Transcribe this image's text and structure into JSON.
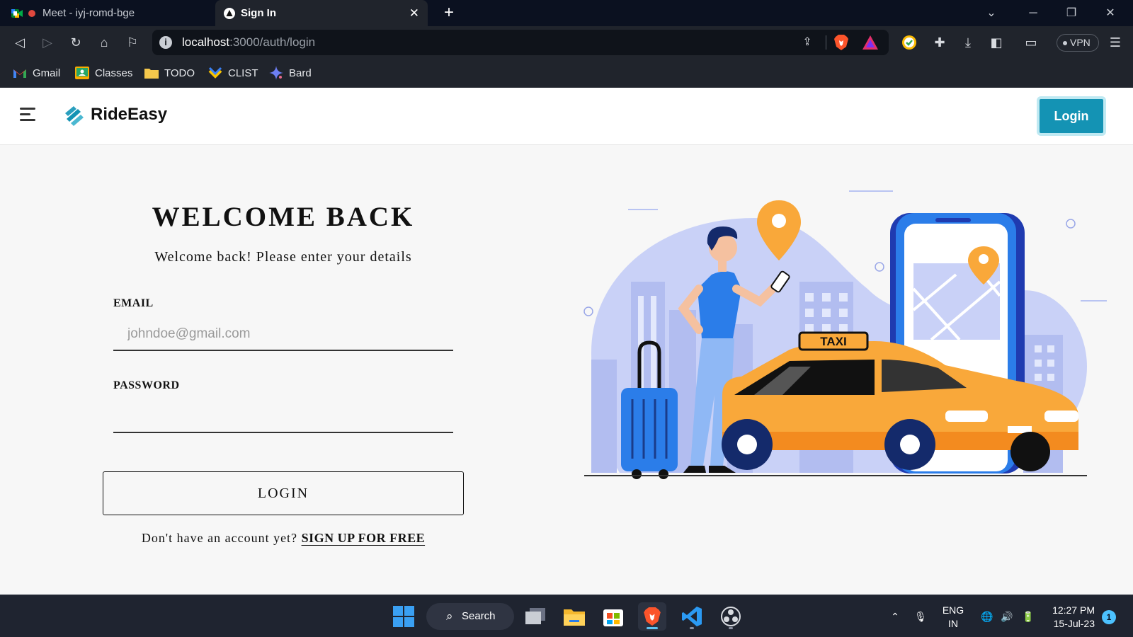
{
  "browser": {
    "tabs": [
      {
        "title": "Meet - iyj-romd-bge",
        "active": false
      },
      {
        "title": "Sign In",
        "active": true
      }
    ],
    "url_host": "localhost",
    "url_rest": ":3000/auth/login",
    "vpn_label": "VPN",
    "bookmarks": [
      {
        "label": "Gmail",
        "icon": "gmail-icon"
      },
      {
        "label": "Classes",
        "icon": "classroom-icon"
      },
      {
        "label": "TODO",
        "icon": "folder-icon"
      },
      {
        "label": "CLIST",
        "icon": "clist-icon"
      },
      {
        "label": "Bard",
        "icon": "bard-icon"
      }
    ]
  },
  "app": {
    "brand": "RideEasy",
    "header_login": "Login",
    "accent_color": "#1493b4"
  },
  "login": {
    "title": "WELCOME BACK",
    "subtitle": "Welcome back! Please enter your details",
    "email_label": "EMAIL",
    "email_placeholder": "johndoe@gmail.com",
    "email_value": "",
    "password_label": "PASSWORD",
    "password_value": "",
    "submit_label": "LOGIN",
    "signup_prompt": "Don't have an account yet?",
    "signup_link": "SIGN UP FOR FREE"
  },
  "illustration": {
    "taxi_sign": "TAXI",
    "taxi_color": "#f9a83a",
    "phone_color": "#2b7de9"
  },
  "taskbar": {
    "search_label": "Search",
    "language_line1": "ENG",
    "language_line2": "IN",
    "time": "12:27 PM",
    "date": "15-Jul-23",
    "notification_count": "1"
  }
}
